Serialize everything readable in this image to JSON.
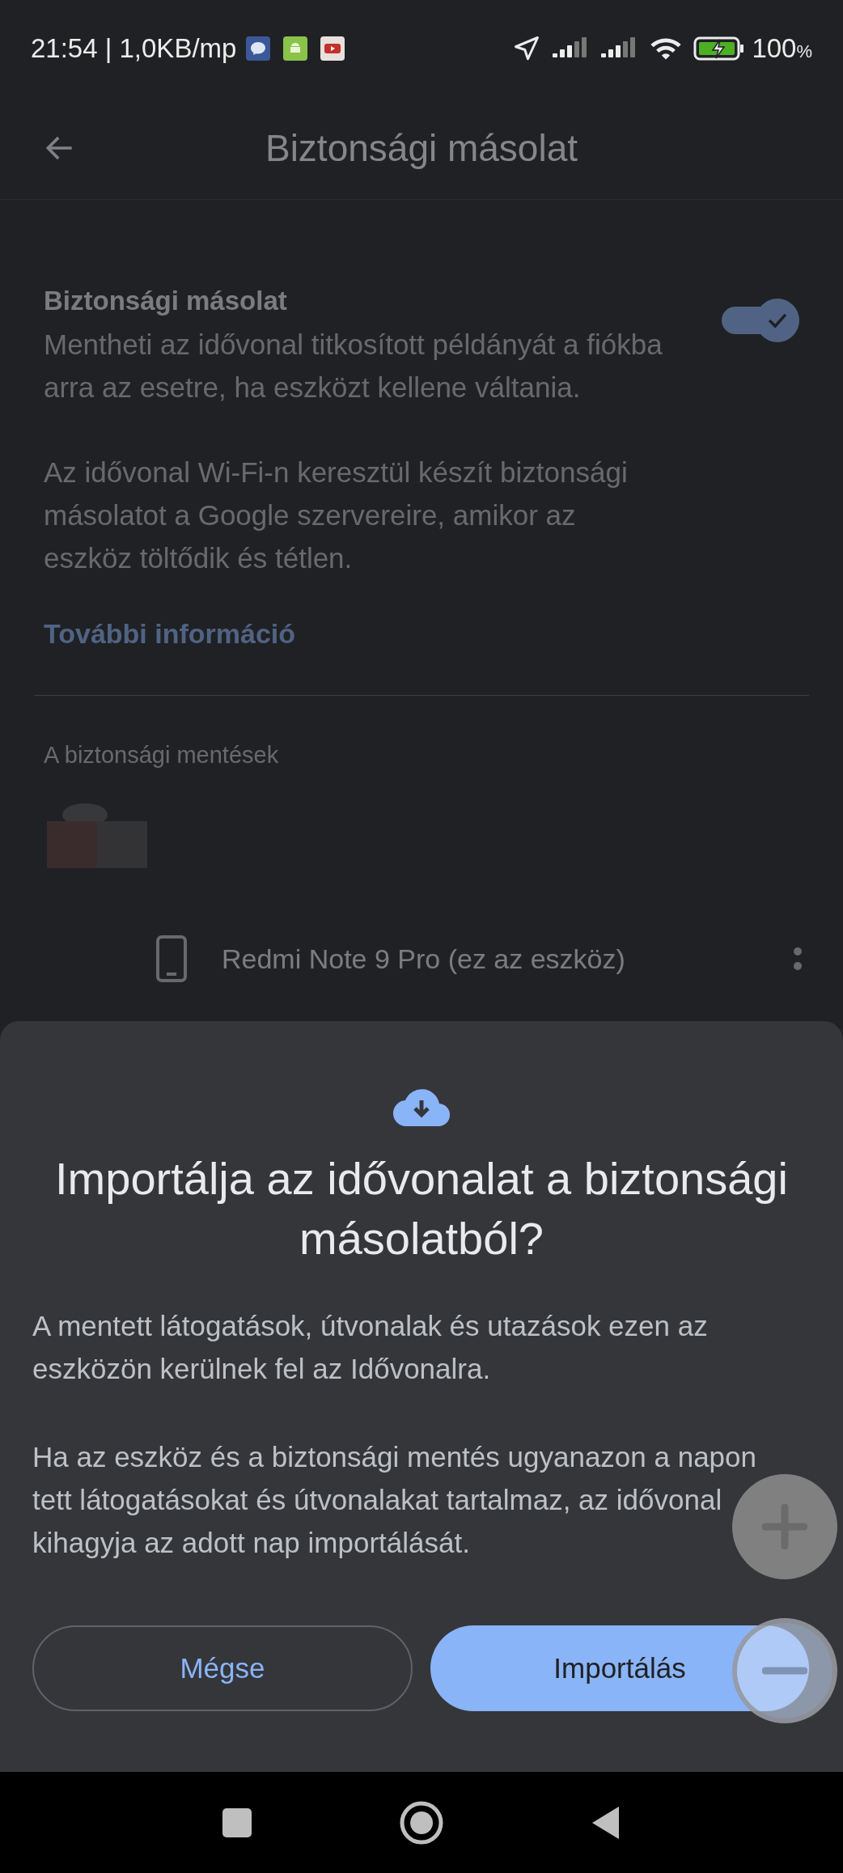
{
  "status_bar": {
    "time": "21:54 | 1,0KB/mp",
    "battery": "100",
    "battery_unit": "%"
  },
  "app_bar": {
    "title": "Biztonsági másolat"
  },
  "backup_setting": {
    "title": "Biztonsági másolat",
    "on": true,
    "paragraphs": [
      "Mentheti az idővonal titkosított példányát a fiókba arra az esetre, ha eszközt kellene váltania.",
      "Az idővonal Wi-Fi-n keresztül készít biztonsági másolatot a Google szervereire, amikor az eszköz töltődik és tétlen."
    ],
    "link": "További információ"
  },
  "backups": {
    "header": "A biztonsági mentések",
    "device": {
      "name": "Redmi Note 9 Pro (ez az eszköz)"
    }
  },
  "sheet": {
    "title": "Importálja az idővonalat a biztonsági másolatból?",
    "paragraphs": [
      "A mentett látogatások, útvonalak és utazások ezen az eszközön kerülnek fel az Idővonalra.",
      "Ha az eszköz és a biztonsági mentés ugyanazon a napon tett látogatásokat és útvonalakat tartalmaz, az idővonal kihagyja az adott nap importálását."
    ],
    "cancel": "Mégse",
    "confirm": "Importálás"
  }
}
